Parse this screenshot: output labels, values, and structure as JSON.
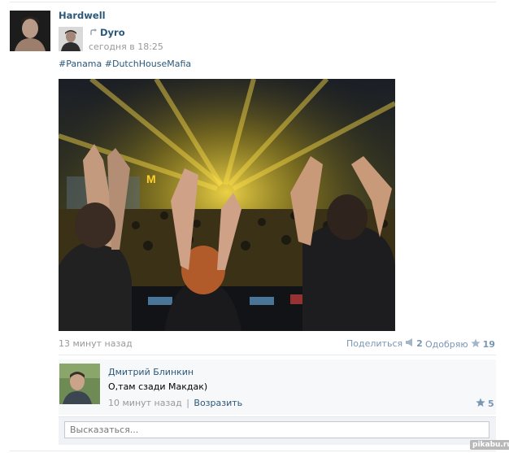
{
  "post": {
    "author": "Hardwell",
    "repost": {
      "author": "Dyro",
      "time": "сегодня в 18:25"
    },
    "tags": "#Panama #DutchHouseMafia",
    "time": "13 минут назад",
    "share_label": "Поделиться",
    "share_count": "2",
    "like_label": "Одобряю",
    "like_count": "19"
  },
  "comment": {
    "author": "Дмитрий Блинкин",
    "text": "О,там сзади Макдак)",
    "time": "10 минут назад",
    "separator": "|",
    "reply_label": "Возразить",
    "like_count": "5"
  },
  "reply": {
    "placeholder": "Высказаться..."
  },
  "watermark": "pikabu.ru",
  "colors": {
    "link": "#2b587a",
    "meta": "#999999",
    "count": "#7a96b5"
  },
  "icons": {
    "repost": "repost-arrow-icon",
    "share": "megaphone-icon",
    "like": "star-icon"
  }
}
